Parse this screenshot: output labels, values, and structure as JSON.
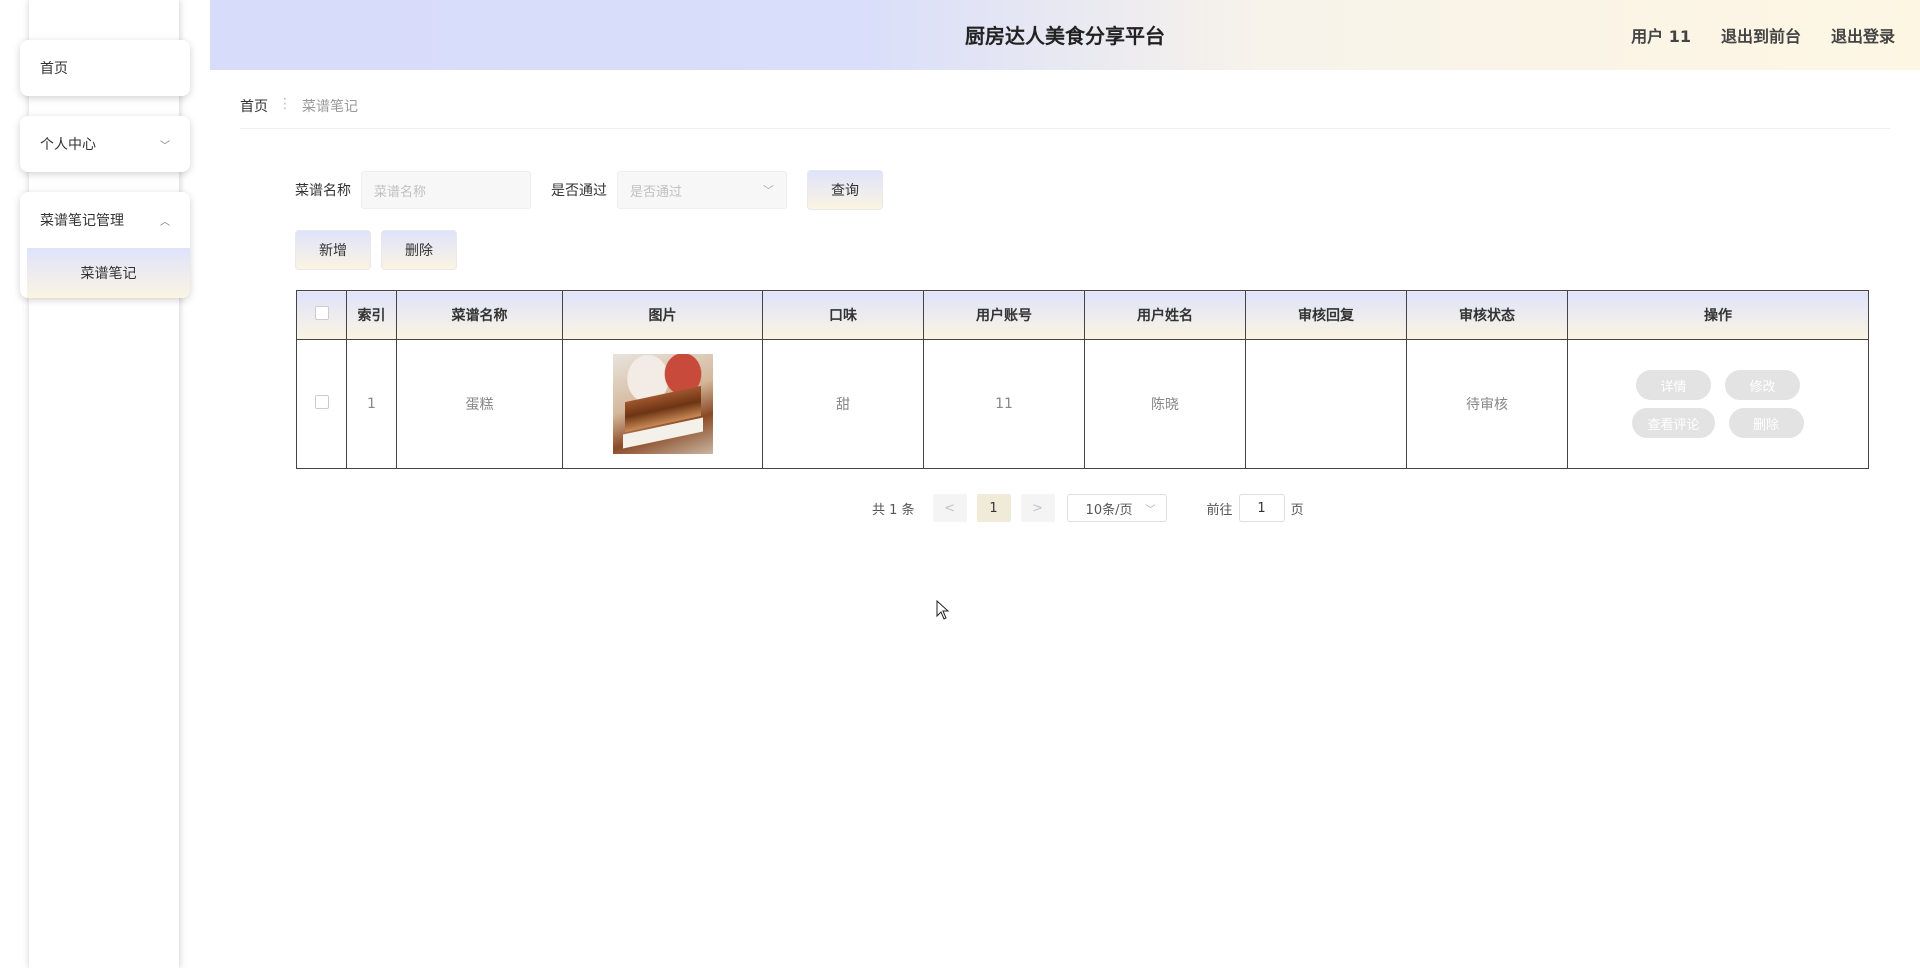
{
  "header": {
    "title": "厨房达人美食分享平台",
    "user": "用户 11",
    "back_to_front": "退出到前台",
    "logout": "退出登录"
  },
  "sidebar": {
    "items": [
      {
        "label": "首页"
      },
      {
        "label": "个人中心"
      },
      {
        "label": "菜谱笔记管理"
      }
    ],
    "sub_items": [
      {
        "label": "菜谱笔记"
      }
    ]
  },
  "breadcrumb": {
    "home": "首页",
    "separator": "⋮",
    "current": "菜谱笔记"
  },
  "search": {
    "name_label": "菜谱名称",
    "name_placeholder": "菜谱名称",
    "pass_label": "是否通过",
    "pass_placeholder": "是否通过",
    "query_button": "查询"
  },
  "toolbar": {
    "add_button": "新增",
    "delete_button": "删除"
  },
  "table": {
    "columns": [
      "索引",
      "菜谱名称",
      "图片",
      "口味",
      "用户账号",
      "用户姓名",
      "审核回复",
      "审核状态",
      "操作"
    ],
    "rows": [
      {
        "index": "1",
        "name": "蛋糕",
        "taste": "甜",
        "account": "11",
        "username": "陈晓",
        "reply": "",
        "status": "待审核",
        "actions": {
          "detail": "详情",
          "edit": "修改",
          "comments": "查看评论",
          "delete": "删除"
        }
      }
    ]
  },
  "pagination": {
    "total": "共 1 条",
    "prev": "<",
    "page": "1",
    "next": ">",
    "page_size": "10条/页",
    "goto_label": "前往",
    "goto_value": "1",
    "goto_suffix": "页"
  },
  "colors": {
    "accent_gradient_start": "#dfe3fb",
    "accent_gradient_end": "#fbf4e2",
    "action_button": "#e3e3e3"
  }
}
